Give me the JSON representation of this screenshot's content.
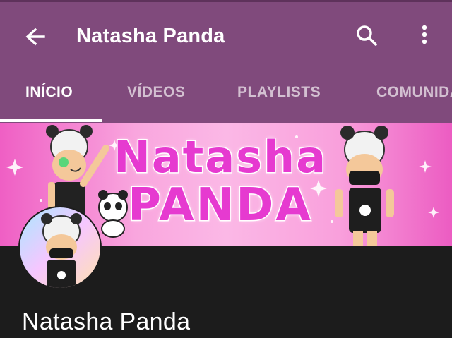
{
  "appbar": {
    "title": "Natasha Panda",
    "back_icon": "arrow-back-icon",
    "search_icon": "search-icon",
    "more_icon": "more-vert-icon",
    "background": "#804a7c"
  },
  "tabs": [
    {
      "label": "INÍCIO",
      "active": true
    },
    {
      "label": "VÍDEOS",
      "active": false
    },
    {
      "label": "PLAYLISTS",
      "active": false
    },
    {
      "label": "COMUNIDADE",
      "active": false
    }
  ],
  "banner": {
    "line1": "Natasha",
    "line2": "PANDA",
    "text_color": "#e63ad0"
  },
  "channel": {
    "name": "Natasha Panda"
  }
}
